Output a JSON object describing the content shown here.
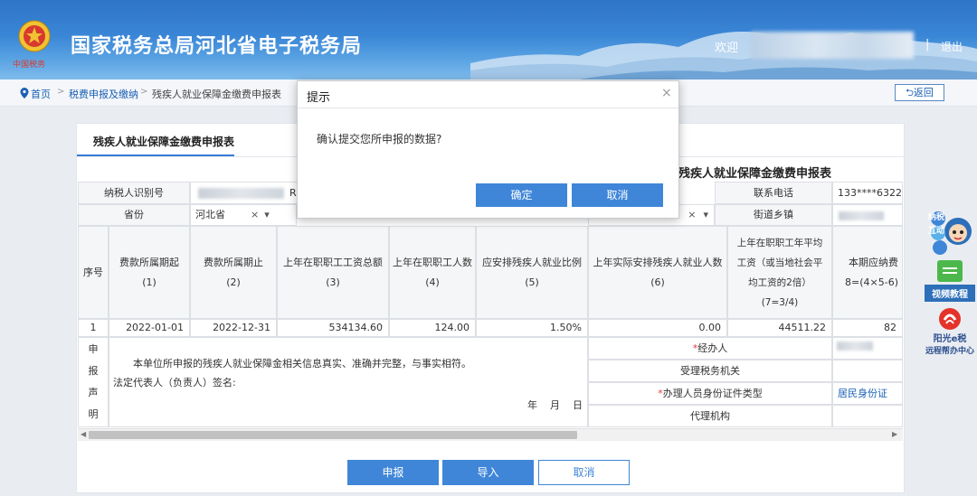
{
  "header": {
    "site_title": "国家税务总局河北省电子税务局",
    "welcome": "欢迎",
    "separator": "|",
    "logout": "退出",
    "logo_text": "中国税务"
  },
  "breadcrumb": {
    "home": "首页",
    "level1": "税费申报及缴纳",
    "current": "残疾人就业保障金缴费申报表",
    "sep": ">"
  },
  "back_button": "返回",
  "tab": {
    "label": "残疾人就业保障金缴费申报表"
  },
  "table_title": "残疾人就业保障金缴费申报表",
  "form": {
    "taxpayer_id_label": "纳税人识别号",
    "taxpayer_id_partial": "R",
    "phone_label": "联系电话",
    "phone_value": "133****6322",
    "province_label": "省份",
    "province_value": "河北省",
    "province_clear": "×",
    "province_arrow": "▾",
    "city_clear": "×",
    "city_arrow": "▾",
    "street_label": "街道乡镇"
  },
  "columns": {
    "seq": "序号",
    "c1": "费款所属期起",
    "c1n": "(1)",
    "c2": "费款所属期止",
    "c2n": "(2)",
    "c3": "上年在职职工工资总额",
    "c3n": "(3)",
    "c4": "上年在职职工人数",
    "c4n": "(4)",
    "c5": "应安排残疾人就业比例",
    "c5n": "(5)",
    "c6": "上年实际安排残疾人就业人数",
    "c6n": "(6)",
    "c7a": "上年在职职工年平均",
    "c7b": "工资（或当地社会平",
    "c7c": "均工资的2倍）",
    "c7d": "(7=3/4)",
    "c8": "本期应纳费",
    "c8n": "8=(4×5-6)"
  },
  "row": {
    "seq": "1",
    "start": "2022-01-01",
    "end": "2022-12-31",
    "wages": "534134.60",
    "staff": "124.00",
    "ratio": "1.50%",
    "actual": "0.00",
    "avg": "44511.22",
    "due": "82"
  },
  "declaration": {
    "side_chars": [
      "申",
      "报",
      "声",
      "明"
    ],
    "statement": "本单位所申报的残疾人就业保障金相关信息真实、准确并完整，与事实相符。",
    "signature": "法定代表人（负责人）签名:",
    "year": "年",
    "month": "月",
    "day": "日",
    "agent_label": "经办人",
    "req_mark": "*",
    "tax_office_label": "受理税务机关",
    "id_type_label": "办理人员身份证件类型",
    "id_type_value": "居民身份证",
    "agency_label": "代理机构"
  },
  "scroll": {
    "left": "◀",
    "right": "▶"
  },
  "buttons": {
    "declare": "申报",
    "import": "导入",
    "cancel": "取消"
  },
  "modal": {
    "title": "提示",
    "close": "×",
    "message": "确认提交您所申报的数据?",
    "confirm": "确定",
    "cancel": "取消"
  },
  "side": {
    "mascot_text": "纳税互动",
    "video_label": "视频教程",
    "sunshine_brand": "阳光e税",
    "remote_help": "远程帮办中心"
  },
  "colors": {
    "accent": "#3f86d8",
    "link": "#1a5fb4",
    "required": "#e03a3a",
    "header": "#2f74c7"
  }
}
